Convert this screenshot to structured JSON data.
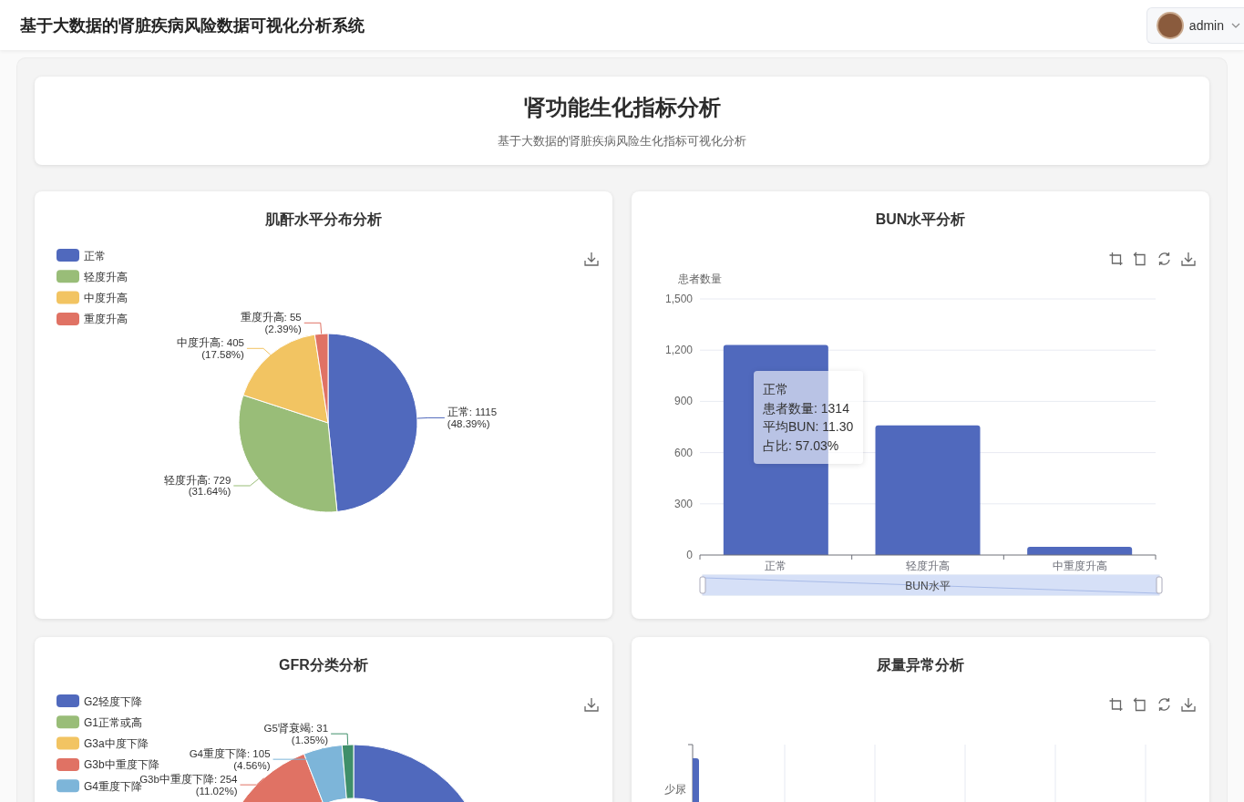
{
  "header": {
    "title": "基于大数据的肾脏疾病风险数据可视化分析系统",
    "user": {
      "name": "admin"
    }
  },
  "page_heading": {
    "title": "肾功能生化指标分析",
    "subtitle": "基于大数据的肾脏疾病风险生化指标可视化分析"
  },
  "cards": [
    {
      "kind": "pie",
      "title": "肌酐水平分布分析",
      "tools": [
        {
          "kind": "download"
        }
      ],
      "chart_data": {
        "type": "pie",
        "categories": [
          "正常",
          "轻度升高",
          "中度升高",
          "重度升高"
        ],
        "values": [
          48.39,
          31.64,
          17.58,
          2.39
        ],
        "colors": [
          "#5069bd",
          "#99bd78",
          "#f2c462",
          "#e07264"
        ],
        "legend": "top-left",
        "value_labels": [
          [
            "正常: 1115",
            "(48.39%)"
          ],
          [
            "轻度升高: 729",
            "(31.64%)"
          ],
          [
            "中度升高: 405",
            "(17.58%)"
          ],
          [
            "重度升高: 55",
            "(2.39%)"
          ]
        ]
      }
    },
    {
      "kind": "bar",
      "title": "BUN水平分析",
      "tools": [
        {
          "kind": "zoom"
        },
        {
          "kind": "zoom_back"
        },
        {
          "kind": "restore"
        },
        {
          "kind": "download"
        }
      ],
      "chart_data": {
        "type": "bar",
        "xlabel": "BUN水平",
        "ylabel": "患者数量",
        "categories": [
          "正常",
          "轻度升高",
          "中重度升高"
        ],
        "series": [
          {
            "color": "#5069bd",
            "values": [
              1230,
              760,
              48
            ]
          }
        ],
        "grid": true,
        "ylim": [
          0,
          1500
        ],
        "yticks": [
          0,
          300,
          600,
          900,
          {
            "value": 1200,
            "label": "1,200"
          },
          {
            "value": 1500,
            "label": "1,500"
          }
        ]
      },
      "slider": {
        "level": 1
      },
      "tooltip": {
        "title": "正常",
        "lines": [
          "患者数量: 1314",
          "平均BUN: 11.30",
          "占比: 57.03%"
        ]
      }
    },
    {
      "kind": "donut",
      "title": "GFR分类分析",
      "tools": [
        {
          "kind": "download"
        }
      ],
      "legend": [
        {
          "label": "G2轻度下降",
          "color": "#5069bd"
        },
        {
          "label": "G1正常或高",
          "color": "#99bd78"
        },
        {
          "label": "G3a中度下降",
          "color": "#f2c462"
        },
        {
          "label": "G3b中重度下降",
          "color": "#e07264"
        },
        {
          "label": "G4重度下降",
          "color": "#7db5d9"
        }
      ],
      "slice_labels": [
        [
          "G5肾衰竭: 31",
          "(1.35%)"
        ],
        [
          "G4重度下降: 105",
          "(4.56%)"
        ],
        [
          "G3b中重度下降: 254",
          "(11.02%)"
        ]
      ]
    },
    {
      "kind": "hbar",
      "title": "尿量异常分析",
      "tools": [
        {
          "kind": "zoom"
        },
        {
          "kind": "zoom_back"
        },
        {
          "kind": "restore"
        },
        {
          "kind": "download"
        }
      ],
      "categories": [
        "少尿"
      ]
    }
  ]
}
